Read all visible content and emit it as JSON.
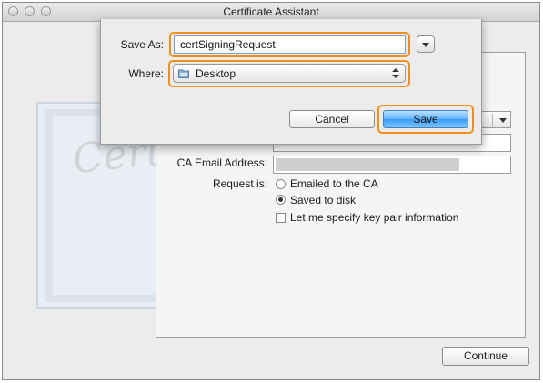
{
  "window": {
    "title": "Certificate Assistant"
  },
  "sheet": {
    "save_as_label": "Save As:",
    "save_as_value": "certSigningRequest",
    "where_label": "Where:",
    "where_value": "Desktop",
    "cancel_label": "Cancel",
    "save_label": "Save"
  },
  "form": {
    "ca_email_label": "CA Email Address:",
    "request_is_label": "Request is:",
    "options": [
      {
        "label": "Emailed to the CA",
        "selected": false
      },
      {
        "label": "Saved to disk",
        "selected": true
      }
    ],
    "specify_keypair_label": "Let me specify key pair information",
    "specify_keypair_checked": false
  },
  "footer": {
    "continue_label": "Continue"
  },
  "background_art": {
    "watermark_text": "Certificate"
  },
  "colors": {
    "highlight": "#f0901a",
    "save_button": "#3a9cf5"
  },
  "icons": {
    "where_folder": "folder-icon",
    "where_popup": "updown-arrows-icon"
  }
}
